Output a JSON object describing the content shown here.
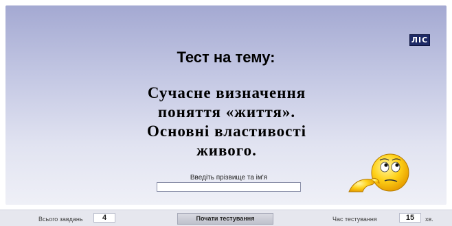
{
  "logo": {
    "text": "ЛІС"
  },
  "header": {
    "title": "Тест на тему:"
  },
  "topic": {
    "lines": [
      "Сучасне визначення",
      "поняття «життя».",
      "Основні властивості",
      "живого."
    ]
  },
  "name": {
    "label": "Введіть прізвище та ім'я",
    "value": "",
    "placeholder": ""
  },
  "footer": {
    "total_tasks_label": "Всього завдань",
    "total_tasks_value": "4",
    "start_button_label": "Почати тестування",
    "time_label": "Час тестування",
    "time_value": "15",
    "time_unit": "хв."
  },
  "icons": {
    "mascot": "thinking-smiley-icon"
  },
  "colors": {
    "stage_top": "#a4a9d2",
    "stage_bottom": "#eff0f7",
    "footer": "#e6e7ee"
  }
}
